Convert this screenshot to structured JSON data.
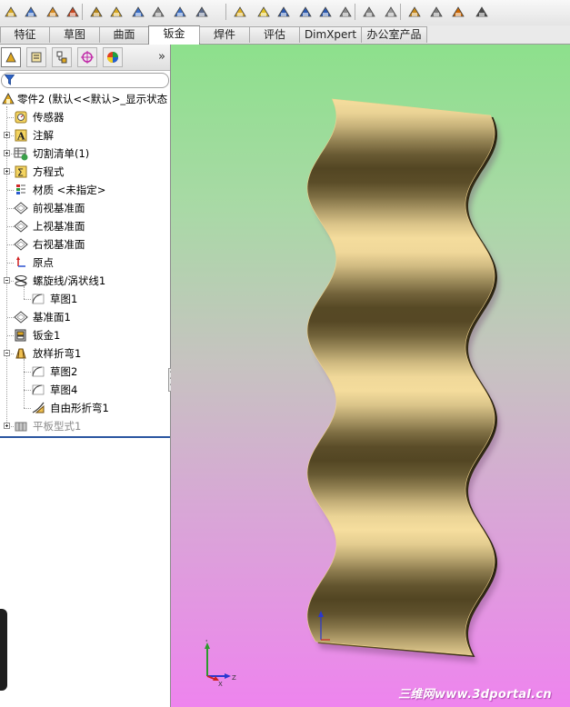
{
  "tabs": [
    {
      "label": "特征",
      "active": false
    },
    {
      "label": "草图",
      "active": false
    },
    {
      "label": "曲面",
      "active": false
    },
    {
      "label": "钣金",
      "active": true
    },
    {
      "label": "焊件",
      "active": false
    },
    {
      "label": "评估",
      "active": false
    },
    {
      "label": "DimXpert",
      "active": false
    },
    {
      "label": "办公室产品",
      "active": false
    }
  ],
  "toolbar_icons": [
    "base-flange-icon",
    "convert-to-sheetmetal-icon",
    "lofted-bend-icon",
    "edge-flange-icon",
    "miter-flange-icon",
    "hem-icon",
    "jog-icon",
    "sketched-bend-icon",
    "cross-break-icon",
    "corners-icon",
    "closed-corner-icon",
    "flatten-icon",
    "no-bends-icon",
    "unfold-icon",
    "fold-icon",
    "insert-bends-icon",
    "rip-icon",
    "vent-icon",
    "forming-tool-icon",
    "simple-hole-icon",
    "extruded-cut-icon",
    "sheet-metal-gusset-icon"
  ],
  "feature_manager": {
    "tabs": [
      "feature-manager-tab",
      "property-manager-tab",
      "configuration-manager-tab",
      "dimxpert-manager-tab",
      "display-manager-tab"
    ],
    "expand_symbol": "»",
    "root": "零件2  (默认<<默认>_显示状态",
    "items": [
      {
        "label": "传感器",
        "icon": "sensor-icon",
        "expandable": false,
        "indent": 1
      },
      {
        "label": "注解",
        "icon": "annotation-icon",
        "expandable": true,
        "indent": 1
      },
      {
        "label": "切割清单(1)",
        "icon": "cut-list-icon",
        "expandable": true,
        "indent": 1
      },
      {
        "label": "方程式",
        "icon": "equation-icon",
        "expandable": true,
        "indent": 1
      },
      {
        "label": "材质 <未指定>",
        "icon": "material-icon",
        "expandable": false,
        "indent": 1
      },
      {
        "label": "前视基准面",
        "icon": "plane-icon",
        "expandable": false,
        "indent": 1
      },
      {
        "label": "上视基准面",
        "icon": "plane-icon",
        "expandable": false,
        "indent": 1
      },
      {
        "label": "右视基准面",
        "icon": "plane-icon",
        "expandable": false,
        "indent": 1
      },
      {
        "label": "原点",
        "icon": "origin-icon",
        "expandable": false,
        "indent": 1
      },
      {
        "label": "螺旋线/涡状线1",
        "icon": "helix-icon",
        "expandable": true,
        "expanded": true,
        "indent": 1
      },
      {
        "label": "草图1",
        "icon": "sketch-icon",
        "expandable": false,
        "indent": 2
      },
      {
        "label": "基准面1",
        "icon": "plane-icon",
        "expandable": false,
        "indent": 1
      },
      {
        "label": "钣金1",
        "icon": "sheet-metal-icon",
        "expandable": false,
        "indent": 1
      },
      {
        "label": "放样折弯1",
        "icon": "lofted-bend-icon",
        "expandable": true,
        "expanded": true,
        "indent": 1
      },
      {
        "label": "草图2",
        "icon": "sketch-icon",
        "expandable": false,
        "indent": 2
      },
      {
        "label": "草图4",
        "icon": "sketch-icon",
        "expandable": false,
        "indent": 2
      },
      {
        "label": "自由形折弯1",
        "icon": "flexible-bend-icon",
        "expandable": false,
        "indent": 2
      },
      {
        "label": "平板型式1",
        "icon": "flat-pattern-icon",
        "expandable": true,
        "indent": 1,
        "suppressed": true
      }
    ]
  },
  "viewport": {
    "triad_labels": {
      "x": "X",
      "y": "Y",
      "z": "Z"
    },
    "watermark": "三维网www.3dportal.cn",
    "part_color": "#f2d48f",
    "background_top": "#8de08c",
    "background_bottom": "#ee84ee"
  }
}
